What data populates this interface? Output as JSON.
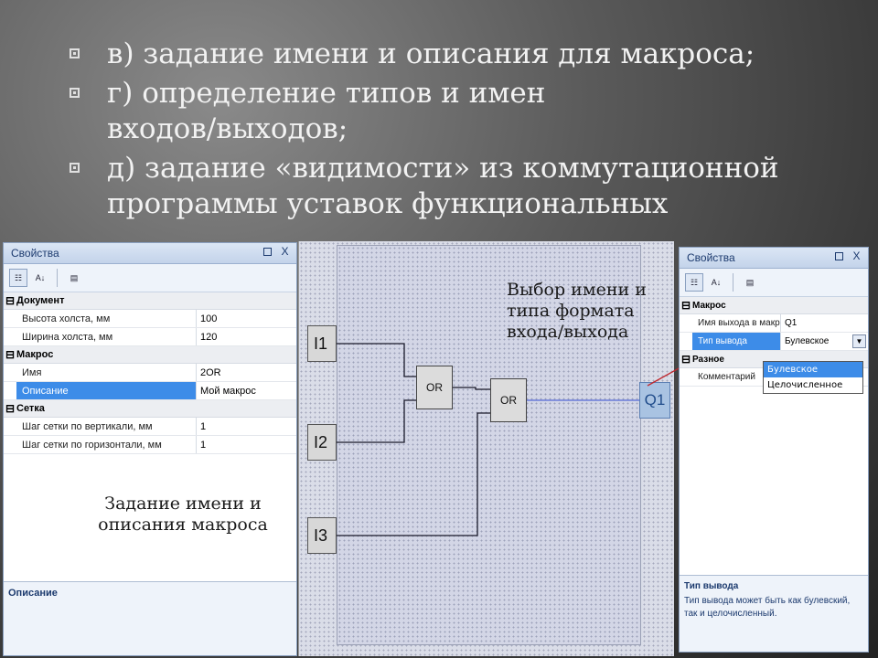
{
  "slide": {
    "bullets": [
      "в) задание имени и описания для макроса;",
      "г) определение типов и имен входов/выходов;",
      "д) задание «видимости» из коммутационной программы уставок функциональных"
    ]
  },
  "left_panel": {
    "title": "Свойства",
    "pin_label": "",
    "close_label": "X",
    "categories": [
      {
        "name": "Документ",
        "rows": [
          {
            "key": "Высота холста, мм",
            "value": "100"
          },
          {
            "key": "Ширина холста, мм",
            "value": "120"
          }
        ]
      },
      {
        "name": "Макрос",
        "rows": [
          {
            "key": "Имя",
            "value": "2OR"
          },
          {
            "key": "Описание",
            "value": "Мой макрос"
          }
        ]
      },
      {
        "name": "Сетка",
        "rows": [
          {
            "key": "Шаг сетки по вертикали, мм",
            "value": "1"
          },
          {
            "key": "Шаг сетки по горизонтали, мм",
            "value": "1"
          }
        ]
      }
    ],
    "description_title": "Описание"
  },
  "annotations": {
    "left": "Задание имени и описания макроса",
    "right": "Выбор имени и типа формата входа/выхода"
  },
  "diagram": {
    "inputs": [
      "I1",
      "I2",
      "I3"
    ],
    "gates": [
      "OR",
      "OR"
    ],
    "output": "Q1"
  },
  "right_panel": {
    "title": "Свойства",
    "close_label": "X",
    "cat_macro": "Макрос",
    "row_name_key": "Имя выхода в макрос",
    "row_name_value": "Q1",
    "row_type_key": "Тип вывода",
    "row_type_value": "Булевское",
    "cat_misc": "Разное",
    "row_comment_key": "Комментарий",
    "dropdown_options": [
      "Булевское",
      "Целочисленное"
    ],
    "description_title": "Тип вывода",
    "description_text": "Тип вывода может быть как булевский, так и целочисленный."
  },
  "colors": {
    "accent": "#3d8ce8",
    "arrow": "#c0282e",
    "output": "#a9c3e2"
  }
}
